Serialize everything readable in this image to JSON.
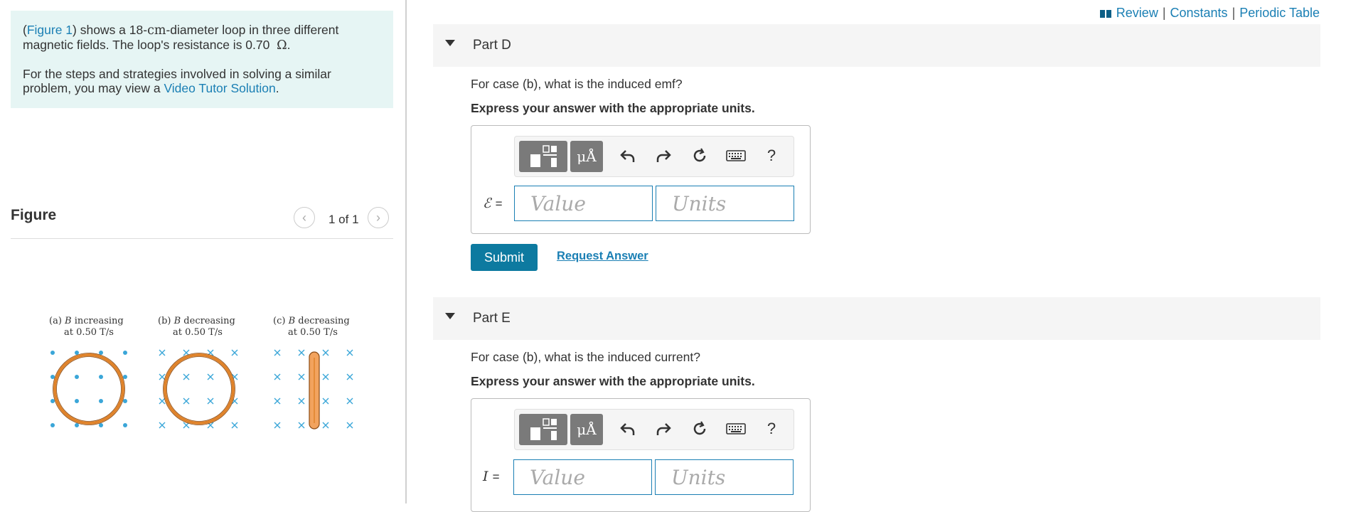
{
  "intro": {
    "figure_link": "Figure 1",
    "line1_a": ") shows a 18-",
    "line1_unit": "cm",
    "line1_b": "-diameter loop in three different magnetic fields. The loop's resistance is 0.70",
    "line1_ohm": "Ω",
    "line1_c": ".",
    "para2_a": "For the steps and strategies involved in solving a similar problem, you may view a",
    "video_link": "Video Tutor Solution",
    "para2_b": "."
  },
  "figure": {
    "title": "Figure",
    "counter": "1 of 1",
    "panels": [
      {
        "label_a": "(a) ",
        "label_b": "B",
        "label_c": " increasing",
        "label_d": "at 0.50 T/s"
      },
      {
        "label_a": "(b) ",
        "label_b": "B",
        "label_c": " decreasing",
        "label_d": "at 0.50 T/s"
      },
      {
        "label_a": "(c) ",
        "label_b": "B",
        "label_c": " decreasing",
        "label_d": "at 0.50 T/s"
      }
    ]
  },
  "toplinks": {
    "review": "Review",
    "constants": "Constants",
    "periodic": "Periodic Table",
    "sep": "|"
  },
  "partD": {
    "title": "Part D",
    "question": "For case (b), what is the induced emf?",
    "instruction": "Express your answer with the appropriate units.",
    "symbol": "ℰ",
    "eq": "=",
    "value_placeholder": "Value",
    "units_placeholder": "Units",
    "submit": "Submit",
    "request": "Request Answer"
  },
  "partE": {
    "title": "Part E",
    "question": "For case (b), what is the induced current?",
    "instruction": "Express your answer with the appropriate units.",
    "symbol": "I",
    "eq": "=",
    "value_placeholder": "Value",
    "units_placeholder": "Units"
  },
  "toolbar": {
    "symbols_label": "μÅ",
    "help": "?"
  },
  "colors": {
    "accent": "#1a7fb4",
    "submit": "#0d7aa0",
    "intro_bg": "#e6f5f4",
    "loop": "#e0832a",
    "field_marks": "#3aa6d8"
  }
}
